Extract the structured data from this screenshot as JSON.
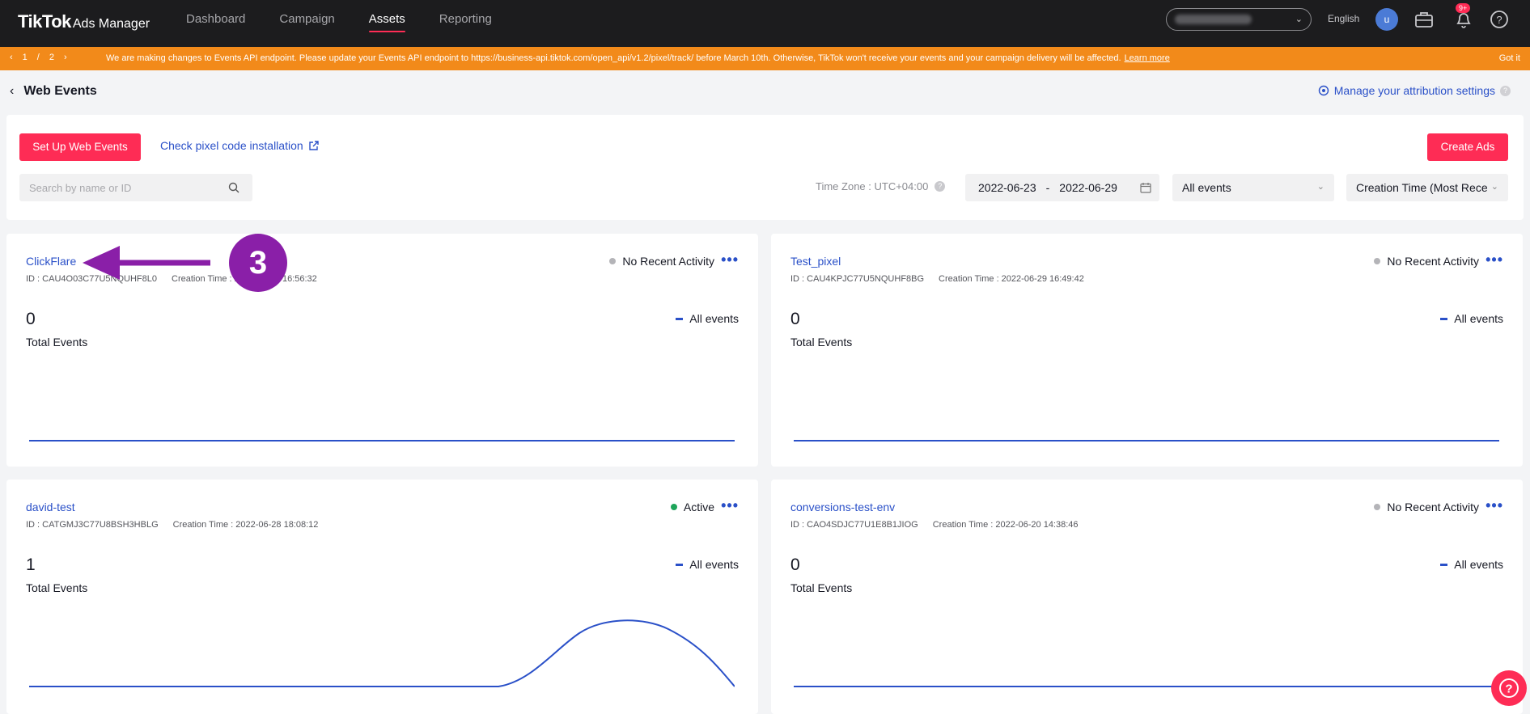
{
  "brand": {
    "name": "TikTok",
    "product": "Ads Manager"
  },
  "nav": {
    "items": [
      "Dashboard",
      "Campaign",
      "Assets",
      "Reporting"
    ],
    "active": "Assets"
  },
  "header": {
    "language": "English",
    "avatar_letter": "u",
    "notification_badge": "9+"
  },
  "banner": {
    "page": "1",
    "page_sep": "/",
    "page_total": "2",
    "message": "We are making changes to Events API endpoint. Please update your Events API endpoint to https://business-api.tiktok.com/open_api/v1.2/pixel/track/ before March 10th. Otherwise, TikTok won't receive your events and your campaign delivery will be affected.",
    "learn_more": "Learn more",
    "got_it": "Got it"
  },
  "page": {
    "title": "Web Events",
    "attribution_link": "Manage your attribution settings"
  },
  "toolbar": {
    "setup_button": "Set Up Web Events",
    "check_link": "Check pixel code installation",
    "create_ads": "Create Ads",
    "search_placeholder": "Search by name or ID",
    "timezone": "Time Zone : UTC+04:00",
    "date_start": "2022-06-23",
    "date_sep": "-",
    "date_end": "2022-06-29",
    "event_filter": "All events",
    "sort": "Creation Time (Most Rece"
  },
  "pixels": [
    {
      "name": "ClickFlare",
      "id": "ID : CAU4O03C77U5NQUHF8L0",
      "created": "Creation Time : 2022-06-29 16:56:32",
      "status": "No Recent Activity",
      "total": "0",
      "total_label": "Total Events",
      "legend": "All events"
    },
    {
      "name": "Test_pixel",
      "id": "ID : CAU4KPJC77U5NQUHF8BG",
      "created": "Creation Time : 2022-06-29 16:49:42",
      "status": "No Recent Activity",
      "total": "0",
      "total_label": "Total Events",
      "legend": "All events"
    },
    {
      "name": "david-test",
      "id": "ID : CATGMJ3C77U8BSH3HBLG",
      "created": "Creation Time : 2022-06-28 18:08:12",
      "status": "Active",
      "total": "1",
      "total_label": "Total Events",
      "legend": "All events"
    },
    {
      "name": "conversions-test-env",
      "id": "ID : CAO4SDJC77U1E8B1JIOG",
      "created": "Creation Time : 2022-06-20 14:38:46",
      "status": "No Recent Activity",
      "total": "0",
      "total_label": "Total Events",
      "legend": "All events"
    }
  ],
  "annotation": {
    "step": "3"
  },
  "colors": {
    "accent": "#fe2c55",
    "link": "#2a50c8",
    "banner": "#f28a1a",
    "annotation": "#8a1fa8",
    "line": "#2a50c8"
  }
}
